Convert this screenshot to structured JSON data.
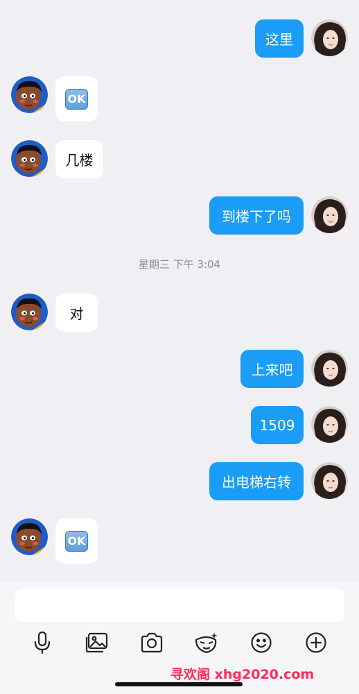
{
  "messages": [
    {
      "side": "out",
      "text": "这里"
    },
    {
      "side": "in",
      "emoji": "OK"
    },
    {
      "side": "in",
      "text": "几楼"
    },
    {
      "side": "out",
      "text": "到楼下了吗"
    },
    {
      "side": "in",
      "text": "对"
    },
    {
      "side": "out",
      "text": "上来吧"
    },
    {
      "side": "out",
      "text": "1509"
    },
    {
      "side": "out",
      "text": "出电梯右转"
    },
    {
      "side": "in",
      "emoji": "OK"
    }
  ],
  "timestamp": "星期三 下午 3:04",
  "input": {
    "value": "",
    "placeholder": ""
  },
  "toolbar": {
    "icons": [
      "microphone-icon",
      "image-icon",
      "camera-icon",
      "mask-icon",
      "smiley-icon",
      "plus-circle-icon"
    ]
  },
  "watermark": "寻欢阁 xhg2020.com",
  "colors": {
    "outgoing_bubble": "#1a9cf7",
    "incoming_bubble": "#ffffff",
    "background": "#efeff4",
    "watermark": "#ff2a5a"
  }
}
